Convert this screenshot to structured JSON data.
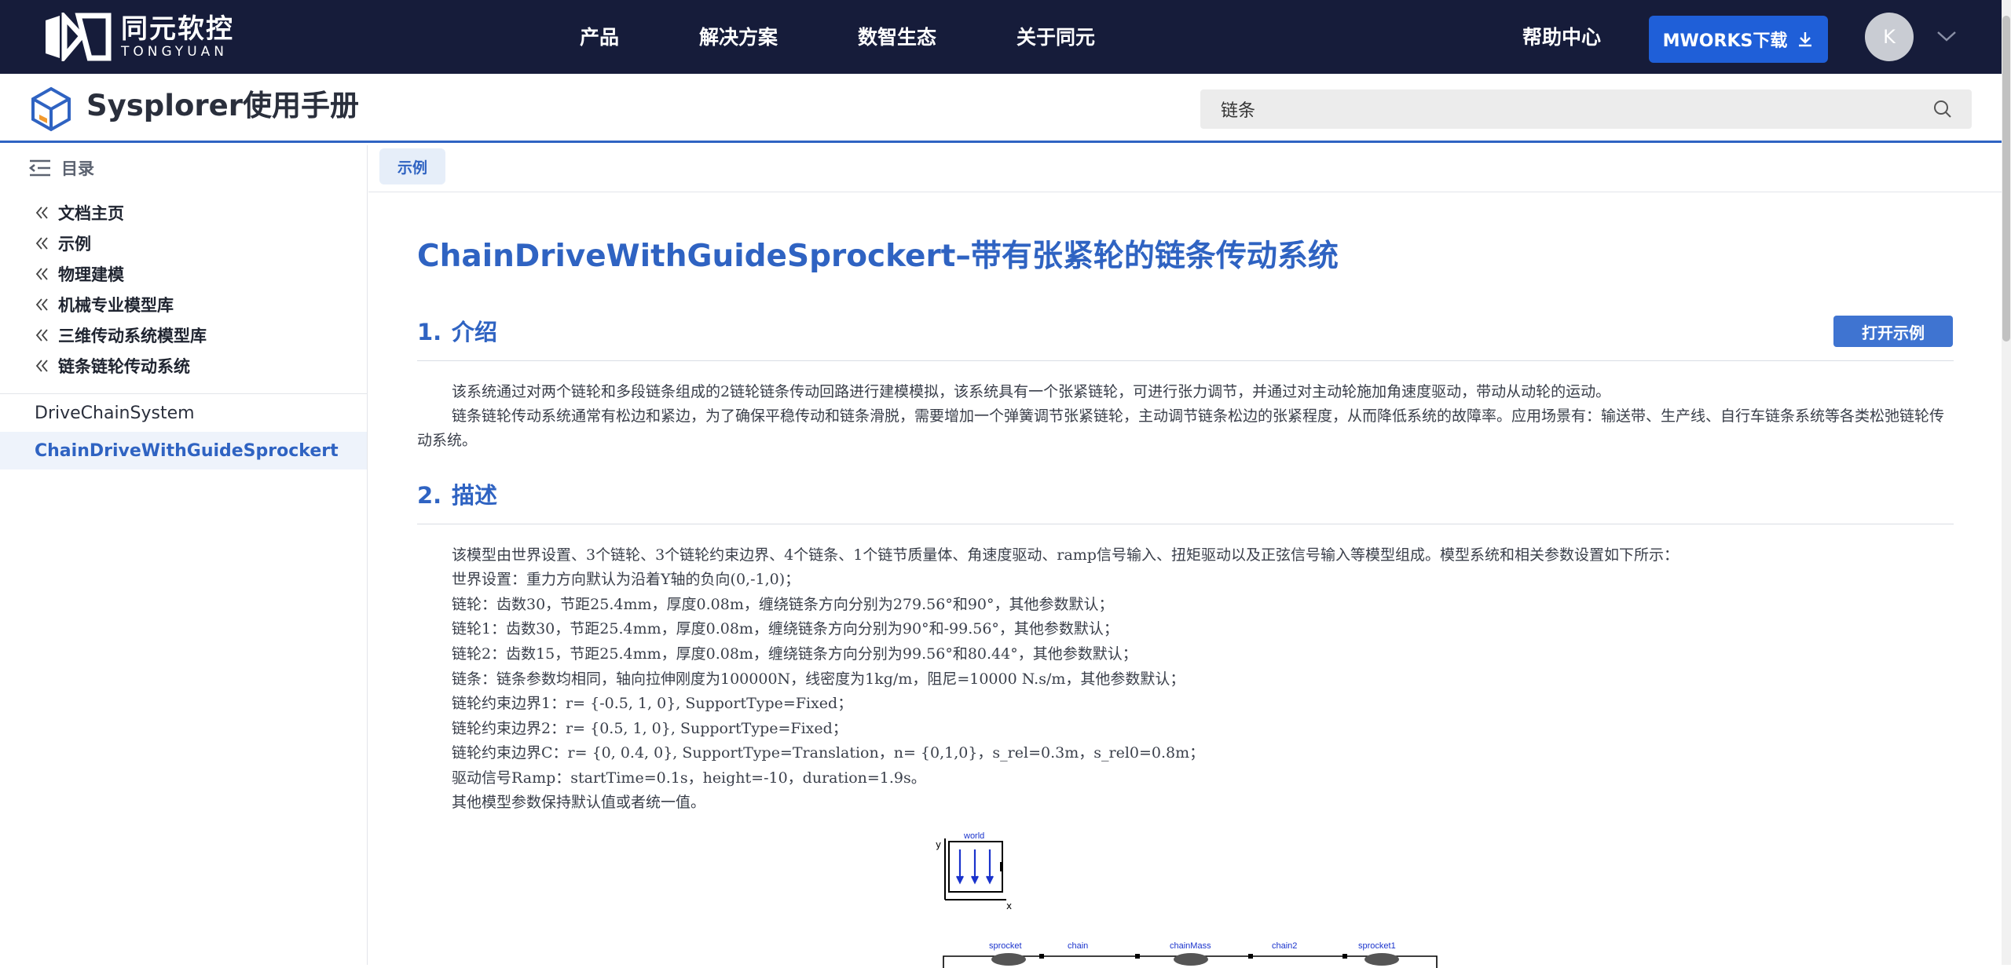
{
  "brand": {
    "name_cn": "同元软控",
    "name_en": "TONGYUAN"
  },
  "topnav": {
    "items": [
      "产品",
      "解决方案",
      "数智生态",
      "关于同元"
    ],
    "help": "帮助中心",
    "download": "MWORKS下载",
    "avatar_initial": "K"
  },
  "manual": {
    "title": "Sysplorer使用手册"
  },
  "search": {
    "value": "链条"
  },
  "sidebar": {
    "toc_label": "目录",
    "breadcrumbs": [
      "文档主页",
      "示例",
      "物理建模",
      "机械专业模型库",
      "三维传动系统模型库",
      "链条链轮传动系统"
    ],
    "items": [
      {
        "label": "DriveChainSystem",
        "active": false
      },
      {
        "label": "ChainDriveWithGuideSprockert",
        "active": true
      }
    ]
  },
  "tabs": [
    "示例"
  ],
  "doc": {
    "title": "ChainDriveWithGuideSprockert–带有张紧轮的链条传动系统",
    "open_example": "打开示例",
    "sections": [
      {
        "num": "1.",
        "title": "介绍"
      },
      {
        "num": "2.",
        "title": "描述"
      }
    ],
    "intro": [
      "该系统通过对两个链轮和多段链条组成的2链轮链条传动回路进行建模模拟，该系统具有一个张紧链轮，可进行张力调节，并通过对主动轮施加角速度驱动，带动从动轮的运动。",
      "链条链轮传动系统通常有松边和紧边，为了确保平稳传动和链条滑脱，需要增加一个弹簧调节张紧链轮，主动调节链条松边的张紧程度，从而降低系统的故障率。应用场景有：输送带、生产线、自行车链条系统等各类松弛链轮传动系统。"
    ],
    "desc_lines": [
      "该模型由世界设置、3个链轮、3个链轮约束边界、4个链条、1个链节质量体、角速度驱动、ramp信号输入、扭矩驱动以及正弦信号输入等模型组成。模型系统和相关参数设置如下所示：",
      "世界设置：重力方向默认为沿着Y轴的负向(0,-1,0)；",
      "链轮：齿数30，节距25.4mm，厚度0.08m，缠绕链条方向分别为279.56°和90°，其他参数默认；",
      "链轮1：齿数30，节距25.4mm，厚度0.08m，缠绕链条方向分别为90°和-99.56°，其他参数默认；",
      "链轮2：齿数15，节距25.4mm，厚度0.08m，缠绕链条方向分别为99.56°和80.44°，其他参数默认；",
      "链条：链条参数均相同，轴向拉伸刚度为100000N，线密度为1kg/m，阻尼=10000 N.s/m，其他参数默认；",
      "链轮约束边界1：r= {-0.5, 1, 0}, SupportType=Fixed；",
      "链轮约束边界2：r= {0.5, 1, 0}, SupportType=Fixed；",
      "链轮约束边界C：r= {0, 0.4, 0}, SupportType=Translation，n= {0,1,0}，s_rel=0.3m，s_rel0=0.8m；",
      "驱动信号Ramp：startTime=0.1s，height=-10，duration=1.9s。",
      "其他模型参数保持默认值或者统一值。"
    ],
    "diagram": {
      "labels": [
        "world",
        "y",
        "x",
        "sprocket",
        "chain",
        "chainMass",
        "chain2",
        "sprocket1"
      ]
    }
  },
  "colors": {
    "nav_bg": "#161c3a",
    "accent": "#2f63c2",
    "download_btn": "#1f5fd8"
  }
}
